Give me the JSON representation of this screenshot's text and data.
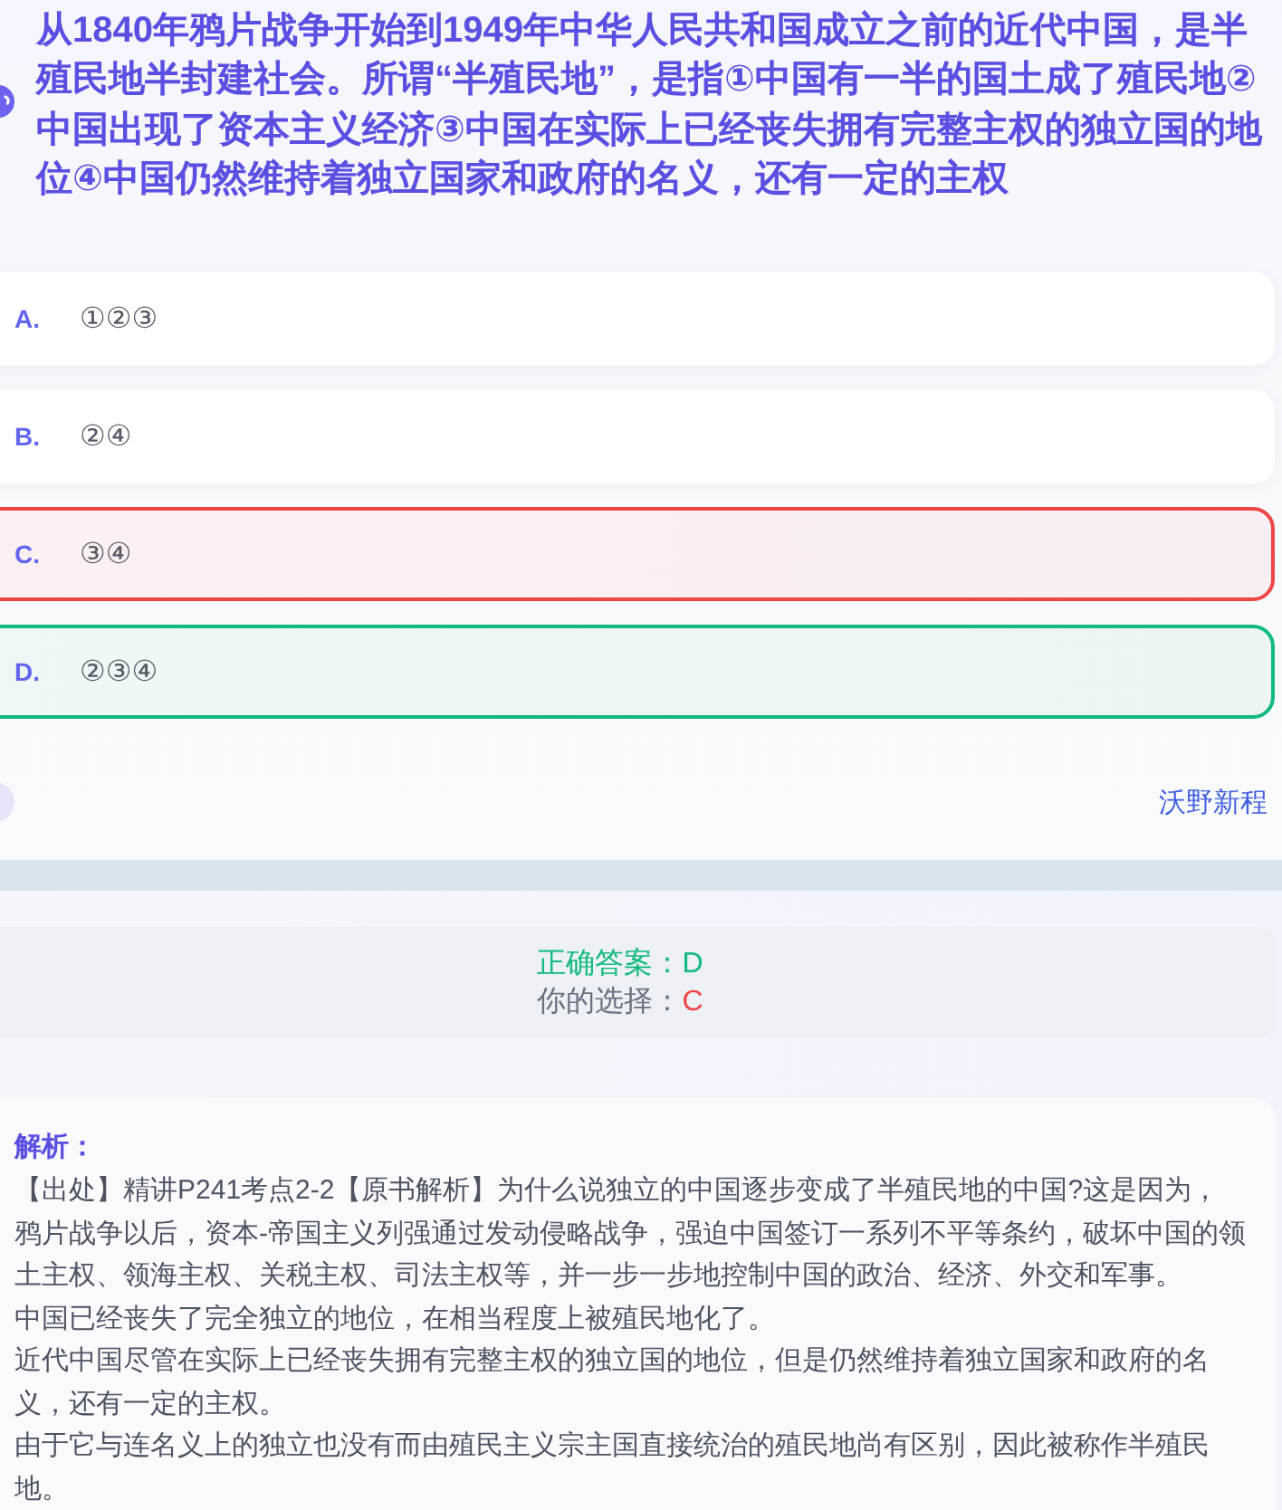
{
  "question": {
    "text": "从1840年鸦片战争开始到1949年中华人民共和国成立之前的近代中国，是半殖民地半封建社会。所谓“半殖民地”，是指①中国有一半的国土成了殖民地②中国出现了资本主义经济③中国在实际上已经丧失拥有完整主权的独立国的地位④中国仍然维持着独立国家和政府的名义，还有一定的主权"
  },
  "options": [
    {
      "letter": "A.",
      "text": "①②③",
      "selected": false,
      "correct": false
    },
    {
      "letter": "B.",
      "text": "②④",
      "selected": false,
      "correct": false
    },
    {
      "letter": "C.",
      "text": "③④",
      "selected": true,
      "correct": false
    },
    {
      "letter": "D.",
      "text": "②③④",
      "selected": false,
      "correct": true
    }
  ],
  "footer": {
    "link": "沃野新程"
  },
  "result": {
    "correct_label": "正确答案：",
    "correct_value": "D",
    "choice_label": "你的选择：",
    "choice_value": "C",
    "choice_correct": false
  },
  "analysis": {
    "title": "解析：",
    "paragraphs": [
      "【出处】精讲P241考点2-2【原书解析】为什么说独立的中国逐步变成了半殖民地的中国?这是因为，鸦片战争以后，资本-帝国主义列强通过发动侵略战争，强迫中国签订一系列不平等条约，破坏中国的领土主权、领海主权、关税主权、司法主权等，并一步一步地控制中国的政治、经济、外交和军事。",
      "中国已经丧失了完全独立的地位，在相当程度上被殖民地化了。",
      "近代中国尽管在实际上已经丧失拥有完整主权的独立国的地位，但是仍然维持着独立国家和政府的名义，还有一定的主权。",
      "由于它与连名义上的独立也没有而由殖民主义宗主国直接统治的殖民地尚有区别，因此被称作半殖民地。"
    ]
  }
}
